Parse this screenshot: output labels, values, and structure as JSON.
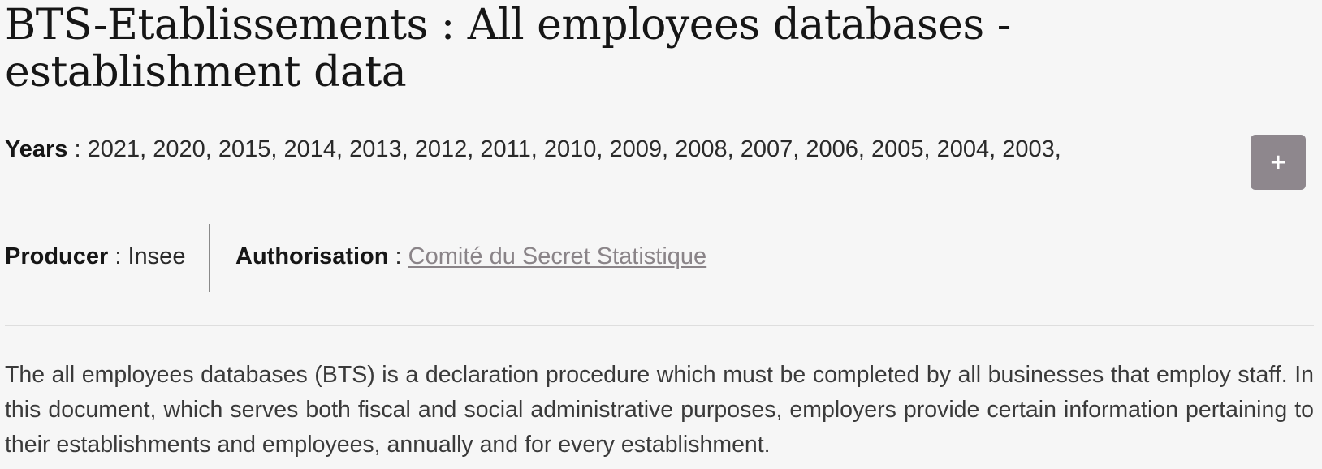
{
  "title": "BTS-Etablissements : All employees databases - establishment data",
  "years": {
    "label": "Years",
    "separator": " : ",
    "value": "2021, 2020, 2015, 2014, 2013, 2012, 2011, 2010, 2009, 2008, 2007, 2006, 2005, 2004, 2003,"
  },
  "expand_button": {
    "label": "+",
    "icon": "plus-icon",
    "color": "#8e878d"
  },
  "producer": {
    "label": "Producer",
    "separator": " : ",
    "value": "Insee"
  },
  "authorisation": {
    "label": "Authorisation",
    "separator": " : ",
    "link_text": "Comité du Secret Statistique",
    "link_color": "#8a8488"
  },
  "description": "The all employees databases (BTS) is a declaration procedure which must be completed by all businesses that employ staff. In this document, which serves both fiscal and social administrative purposes, employers provide certain information pertaining to their establishments and employees, annually and for every establishment."
}
